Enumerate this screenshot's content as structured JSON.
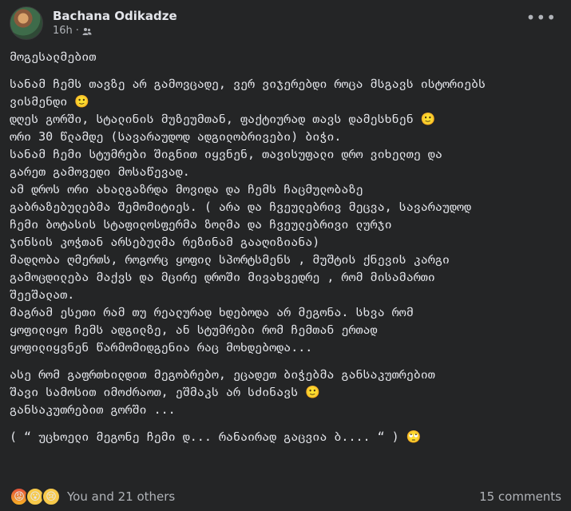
{
  "post": {
    "author": "Bachana Odikadze",
    "time": "16h",
    "separator": "·",
    "privacy_icon": "friends-icon",
    "lines": [
      "მოგესალმებით",
      "",
      "სანამ ჩემს თავზე არ გამოვცადე, ვერ ვიჯერებდი როცა მსგავს ისტორიებს",
      "ვისმენდი 🙂",
      "დღეს გორში, სტალინის მუზეუმთან, ფაქტიურად თავს დამესხნენ 🙂",
      "ორი 30 წლამდე (სავარაუდოდ ადგილობრივები) ბიჭი.",
      "სანამ ჩემი სტუმრები შიგნით იყვნენ, თავისუფალი დრო ვიხელთე და",
      "გარეთ გამოვედი მოსაწევად.",
      "ამ დროს ორი ახალგაზრდა მოვიდა და ჩემს ჩაცმულობაზე",
      "გაბრაზებულებმა შემომიტიეს. ( არა და ჩვეულებრივ მეცვა, სავარაუდოდ",
      "ჩემი ბოტასის სტაფილოსფერმა ზოლმა და ჩვეულებრივი ლურჯი",
      "ჯინსის კოჭთან არსებულმა რეზინამ გააღიზიანა)",
      "მადლობა ღმერთს, როგორც ყოფილ სპორტსმენს , მუშტის ქნევის კარგი",
      "გამოცდილება მაქვს და მცირე დროში მივახვედრე , რომ მისამართი",
      "შეეშალათ.",
      "მაგრამ ესეთი რამ თუ რეალურად ხდებოდა არ მეგონა. სხვა რომ",
      "ყოფილიყო ჩემს ადგილზე, ან სტუმრები რომ ჩემთან ერთად",
      "ყოფილიყვნენ წარმომიდგენია რაც მოხდებოდა...",
      "",
      "ასე რომ გაფრთხილდით მეგობრებო, ეცადეთ ბიჭებმა განსაკუთრებით",
      "შავი სამოსით იმოძრაოთ, ეშმაკს არ სძინავს 🙂",
      "განსაკუთრებით გორში ...",
      "",
      "( “ უცხოელი მეგონე ჩემი დ... რანაირად გაცვია ბ.... “ ) 🙄"
    ]
  },
  "footer": {
    "reactions": [
      "angry",
      "wow",
      "sad"
    ],
    "reaction_glyphs": [
      "😡",
      "😮",
      "😢"
    ],
    "count_text": "You and 21 others",
    "comments_text": "15 comments"
  }
}
